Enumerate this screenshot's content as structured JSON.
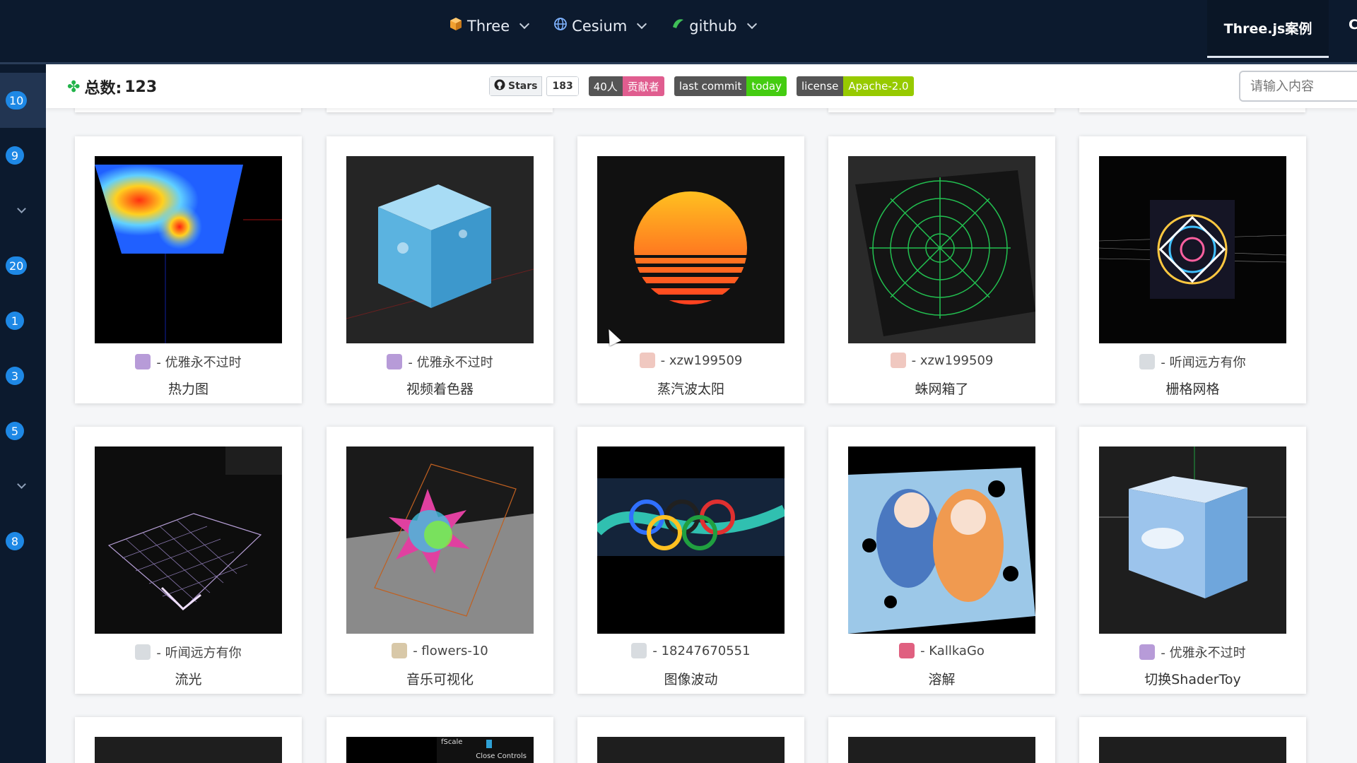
{
  "nav": {
    "items": [
      {
        "label": "Three",
        "icon": "box-icon"
      },
      {
        "label": "Cesium",
        "icon": "globe-icon"
      },
      {
        "label": "github",
        "icon": "github-icon"
      }
    ],
    "active_tab": "Three.js案例",
    "cut_tab": "C"
  },
  "sidebar": {
    "items": [
      {
        "badge": "10",
        "active": true
      },
      {
        "badge": "9"
      },
      {
        "chevron": true
      },
      {
        "badge": "20"
      },
      {
        "badge": "1"
      },
      {
        "badge": "3"
      },
      {
        "badge": "5"
      },
      {
        "chevron": true
      },
      {
        "badge": "8"
      }
    ]
  },
  "header": {
    "total_label": "总数:",
    "total_value": "123",
    "stars_label": "Stars",
    "stars_count": "183",
    "contributors_left": "40人",
    "contributors_right": "贡献者",
    "commit_left": "last commit",
    "commit_right": "today",
    "license_left": "license",
    "license_right": "Apache-2.0",
    "search_placeholder": "请输入内容"
  },
  "colors": {
    "nav_bg": "#0c1a2e",
    "badge_blue": "#1e88e5",
    "contrib_pink": "#e05d8f",
    "commit_green": "#44cc11",
    "license_green": "#97ca00",
    "shield_gray": "#555555"
  },
  "cards": [
    {
      "author": "- 优雅永不过时",
      "title": "热力图",
      "avatar": "elephant-avatar"
    },
    {
      "author": "- 优雅永不过时",
      "title": "视频着色器",
      "avatar": "elephant-avatar"
    },
    {
      "author": "- xzw199509",
      "title": "蒸汽波太阳",
      "avatar": "anime-avatar"
    },
    {
      "author": "- xzw199509",
      "title": "蛛网箱了",
      "avatar": "anime-avatar"
    },
    {
      "author": "- 听闻远方有你",
      "title": "栅格网格",
      "avatar": "plane-avatar"
    },
    {
      "author": "- 听闻远方有你",
      "title": "流光",
      "avatar": "plane-avatar"
    },
    {
      "author": "- flowers-10",
      "title": "音乐可视化",
      "avatar": "cat-avatar"
    },
    {
      "author": "- 18247670551",
      "title": "图像波动",
      "avatar": "plane-avatar"
    },
    {
      "author": "- KallkaGo",
      "title": "溶解",
      "avatar": "rose-avatar"
    },
    {
      "author": "- 优雅永不过时",
      "title": "切换ShaderToy",
      "avatar": "elephant-avatar"
    }
  ],
  "bottom_thumb_text": {
    "label": "fScale",
    "button": "Close Controls"
  }
}
